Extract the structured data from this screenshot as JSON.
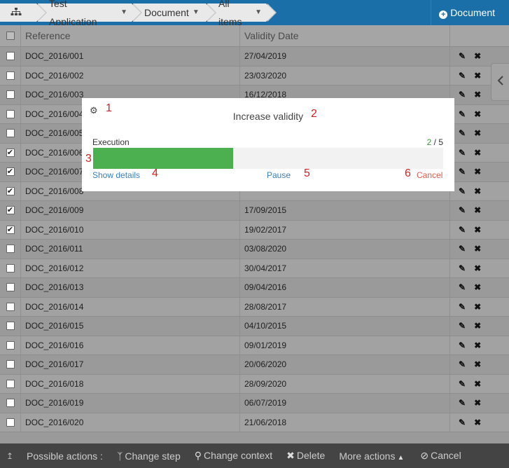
{
  "header": {
    "breadcrumbs": [
      {
        "label": "Test Application"
      },
      {
        "label": "Document"
      },
      {
        "label": "All items"
      }
    ],
    "document_button": "Document"
  },
  "table": {
    "columns": [
      "Reference",
      "Validity Date"
    ],
    "rows": [
      {
        "ref": "DOC_2016/001",
        "date": "27/04/2019",
        "checked": false
      },
      {
        "ref": "DOC_2016/002",
        "date": "23/03/2020",
        "checked": false
      },
      {
        "ref": "DOC_2016/003",
        "date": "16/12/2018",
        "checked": false
      },
      {
        "ref": "DOC_2016/004",
        "date": "",
        "checked": false
      },
      {
        "ref": "DOC_2016/005",
        "date": "",
        "checked": false
      },
      {
        "ref": "DOC_2016/006",
        "date": "",
        "checked": true
      },
      {
        "ref": "DOC_2016/007",
        "date": "",
        "checked": true
      },
      {
        "ref": "DOC_2016/008",
        "date": "",
        "checked": true
      },
      {
        "ref": "DOC_2016/009",
        "date": "17/09/2015",
        "checked": true
      },
      {
        "ref": "DOC_2016/010",
        "date": "19/02/2017",
        "checked": true
      },
      {
        "ref": "DOC_2016/011",
        "date": "03/08/2020",
        "checked": false
      },
      {
        "ref": "DOC_2016/012",
        "date": "30/04/2017",
        "checked": false
      },
      {
        "ref": "DOC_2016/013",
        "date": "09/04/2016",
        "checked": false
      },
      {
        "ref": "DOC_2016/014",
        "date": "28/08/2017",
        "checked": false
      },
      {
        "ref": "DOC_2016/015",
        "date": "04/10/2015",
        "checked": false
      },
      {
        "ref": "DOC_2016/016",
        "date": "09/01/2019",
        "checked": false
      },
      {
        "ref": "DOC_2016/017",
        "date": "20/06/2020",
        "checked": false
      },
      {
        "ref": "DOC_2016/018",
        "date": "28/09/2020",
        "checked": false
      },
      {
        "ref": "DOC_2016/019",
        "date": "06/07/2019",
        "checked": false
      },
      {
        "ref": "DOC_2016/020",
        "date": "21/06/2018",
        "checked": false
      }
    ]
  },
  "modal": {
    "title": "Increase validity",
    "execution_label": "Execution",
    "done": "2",
    "separator": " / ",
    "total": "5",
    "progress_fraction": 0.4,
    "show_details": "Show details",
    "pause": "Pause",
    "cancel": "Cancel",
    "annotations": [
      "1",
      "2",
      "3",
      "4",
      "5",
      "6"
    ]
  },
  "bottom_bar": {
    "possible_actions": "Possible actions :",
    "change_step": "Change step",
    "change_context": "Change context",
    "delete": "Delete",
    "more_actions": "More actions",
    "cancel": "Cancel"
  },
  "colors": {
    "header_blue": "#1a6fa8",
    "progress_green": "#4caf50",
    "link_blue": "#3a7fbf",
    "cancel_red": "#e05a4a",
    "annotation_red": "#d42020"
  },
  "icons": [
    "sitemap-icon",
    "chevron-down-icon",
    "plus-circle-icon",
    "pencil-icon",
    "close-icon",
    "chevron-left-icon",
    "gear-icon",
    "up-arrow-icon",
    "branch-icon",
    "map-marker-icon",
    "caret-up-icon",
    "ban-icon"
  ]
}
